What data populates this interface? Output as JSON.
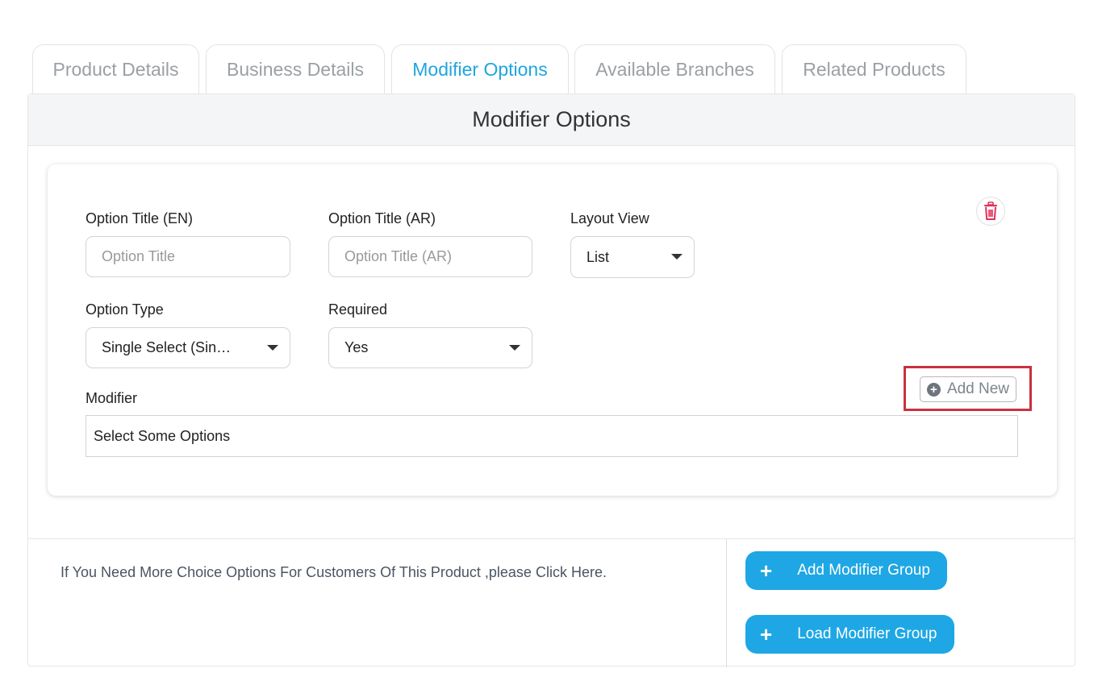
{
  "tabs": [
    {
      "label": "Product Details"
    },
    {
      "label": "Business Details"
    },
    {
      "label": "Modifier Options"
    },
    {
      "label": "Available Branches"
    },
    {
      "label": "Related Products"
    }
  ],
  "active_tab": "Modifier Options",
  "panel": {
    "title": "Modifier Options"
  },
  "form": {
    "option_title_en": {
      "label": "Option Title (EN)",
      "placeholder": "Option Title"
    },
    "option_title_ar": {
      "label": "Option Title (AR)",
      "placeholder": "Option Title (AR)"
    },
    "layout_view": {
      "label": "Layout View",
      "value": "List"
    },
    "option_type": {
      "label": "Option Type",
      "value": "Single Select (Sin…"
    },
    "required": {
      "label": "Required",
      "value": "Yes"
    },
    "modifier": {
      "label": "Modifier",
      "placeholder": "Select Some Options"
    },
    "add_new_label": "Add New"
  },
  "footer": {
    "hint": "If You Need More Choice Options For Customers Of This Product ,please Click Here.",
    "add_group_label": "Add Modifier Group",
    "load_group_label": "Load Modifier Group"
  },
  "colors": {
    "accent": "#1fa6dd",
    "button_blue": "#1ea7e4",
    "highlight_red": "#c9313d",
    "trash_red": "#e0315a"
  },
  "icons": [
    "trash-icon",
    "plus-circle-icon",
    "plus-icon",
    "caret-down-icon"
  ]
}
